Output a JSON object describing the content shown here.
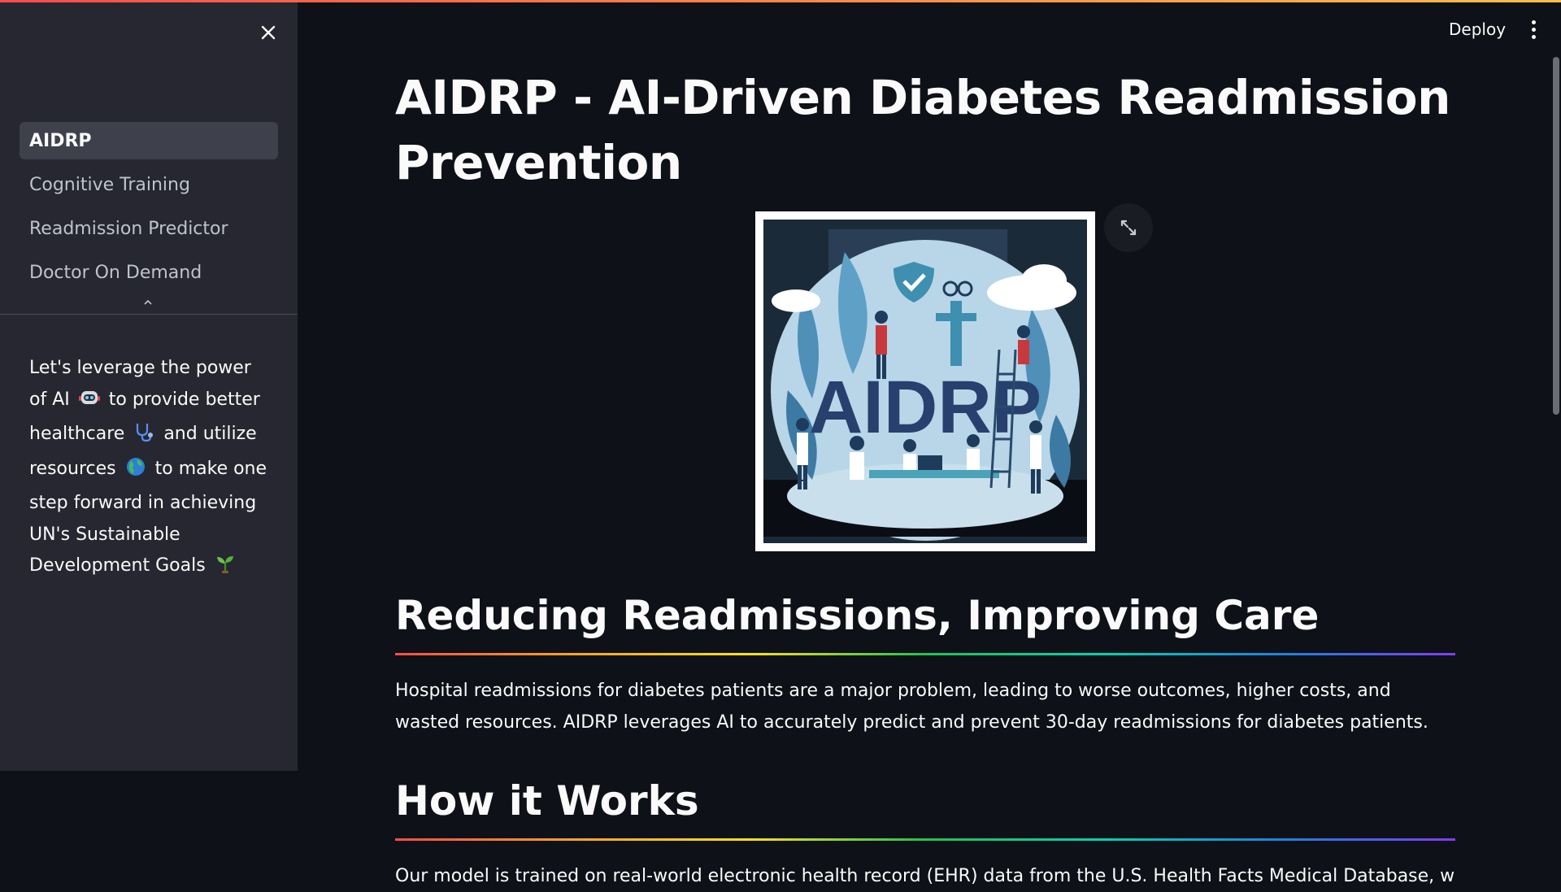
{
  "header": {
    "deploy_label": "Deploy",
    "menu_icon": "kebab-menu-icon",
    "accent_gradient": [
      "#ff4b4b",
      "#ffbd45"
    ]
  },
  "sidebar": {
    "close_icon": "close-icon",
    "nav_items": [
      {
        "label": "AIDRP",
        "active": true
      },
      {
        "label": "Cognitive Training",
        "active": false
      },
      {
        "label": "Readmission Predictor",
        "active": false
      },
      {
        "label": "Doctor On Demand",
        "active": false
      }
    ],
    "collapse_icon": "chevron-up-icon",
    "text_parts": {
      "p1": "Let's leverage the power of AI",
      "p2": "to provide better healthcare",
      "p3": "and utilize resources",
      "p4": "to make one step forward in achieving UN's Sustainable Development Goals"
    },
    "emojis": [
      "robot-emoji",
      "stethoscope-emoji",
      "globe-emoji",
      "seedling-emoji"
    ]
  },
  "main": {
    "title": "AIDRP - AI-Driven Diabetes Readmission Prevention",
    "hero_image": {
      "logo_text": "AIDRP",
      "fullscreen_icon": "expand-icon"
    },
    "sections": [
      {
        "heading": "Reducing Readmissions, Improving Care",
        "body": "Hospital readmissions for diabetes patients are a major problem, leading to worse outcomes, higher costs, and wasted resources. AIDRP leverages AI to accurately predict and prevent 30-day readmissions for diabetes patients."
      },
      {
        "heading": "How it Works",
        "body": "Our model is trained on real-world electronic health record (EHR) data from the U.S. Health Facts Medical Database, which contains"
      }
    ]
  },
  "colors": {
    "background": "#0e1117",
    "sidebar": "#262730",
    "active_nav": "#3e404c",
    "text": "#fafafa",
    "muted_text": "#bfc3cc"
  }
}
